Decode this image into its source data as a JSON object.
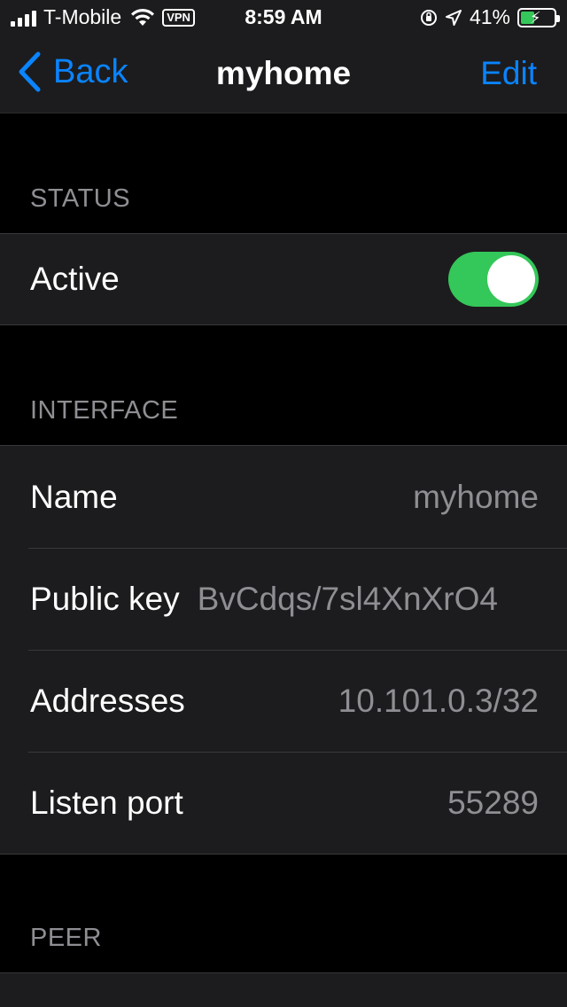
{
  "status_bar": {
    "carrier": "T-Mobile",
    "vpn_badge": "VPN",
    "time": "8:59 AM",
    "battery_percent": "41%",
    "battery_level": 0.41,
    "icons": [
      "signal-icon",
      "wifi-icon",
      "vpn-icon",
      "orientation-lock-icon",
      "location-icon",
      "battery-charging-icon"
    ]
  },
  "nav": {
    "back_label": "Back",
    "title": "myhome",
    "edit_label": "Edit"
  },
  "sections": {
    "status": {
      "header": "STATUS",
      "active_label": "Active",
      "active_on": true
    },
    "interface": {
      "header": "INTERFACE",
      "rows": [
        {
          "label": "Name",
          "value": "myhome"
        },
        {
          "label": "Public key",
          "value": "BvCdqs/7sl4XnXrO4"
        },
        {
          "label": "Addresses",
          "value": "10.101.0.3/32"
        },
        {
          "label": "Listen port",
          "value": "55289"
        }
      ]
    },
    "peer": {
      "header": "PEER"
    }
  },
  "colors": {
    "accent": "#0a84ff",
    "toggle_on": "#34c759",
    "background": "#000000",
    "cell": "#1c1c1e",
    "secondary_text": "#8e8e93"
  }
}
